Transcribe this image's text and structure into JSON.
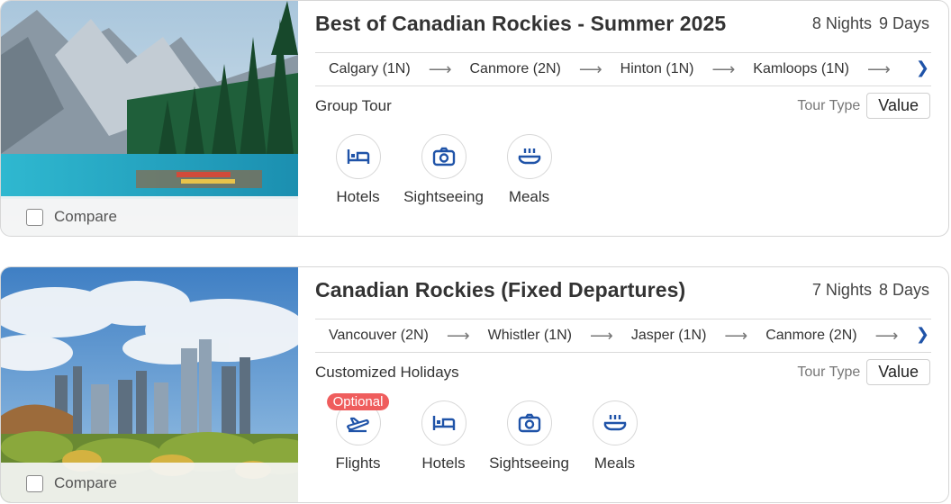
{
  "colors": {
    "accent": "#1f53a8",
    "badge": "#ef5d5d",
    "border": "#d6d6d6"
  },
  "tours": [
    {
      "title": "Best of Canadian Rockies - Summer 2025",
      "nights": "8 Nights",
      "days": "9 Days",
      "route": [
        "Calgary (1N)",
        "Canmore (2N)",
        "Hinton (1N)",
        "Kamloops (1N)"
      ],
      "route_arrow": "⟶",
      "route_next": "❯",
      "category": "Group Tour",
      "tour_type_label": "Tour Type",
      "tour_type_value": "Value",
      "inclusions": [
        {
          "label": "Hotels",
          "icon": "bed-icon"
        },
        {
          "label": "Sightseeing",
          "icon": "camera-icon"
        },
        {
          "label": "Meals",
          "icon": "meal-icon"
        }
      ],
      "compare_label": "Compare",
      "image": "mountain-lake-photo"
    },
    {
      "title": "Canadian Rockies (Fixed Departures)",
      "nights": "7 Nights",
      "days": "8 Days",
      "route": [
        "Vancouver (2N)",
        "Whistler (1N)",
        "Jasper (1N)",
        "Canmore (2N)"
      ],
      "route_arrow": "⟶",
      "route_next": "❯",
      "category": "Customized Holidays",
      "tour_type_label": "Tour Type",
      "tour_type_value": "Value",
      "inclusions": [
        {
          "label": "Flights",
          "icon": "plane-icon",
          "badge": "Optional"
        },
        {
          "label": "Hotels",
          "icon": "bed-icon"
        },
        {
          "label": "Sightseeing",
          "icon": "camera-icon"
        },
        {
          "label": "Meals",
          "icon": "meal-icon"
        }
      ],
      "compare_label": "Compare",
      "image": "city-skyline-photo"
    }
  ]
}
